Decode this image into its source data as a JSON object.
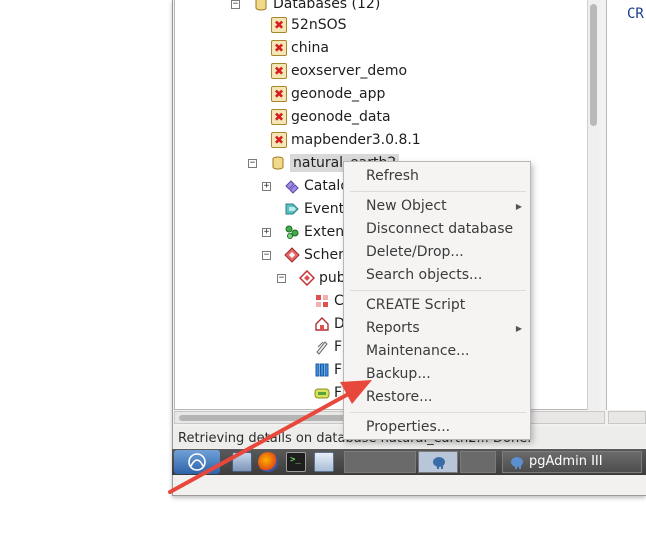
{
  "tree": {
    "items": [
      {
        "label": "Databases (12)"
      },
      {
        "label": "52nSOS"
      },
      {
        "label": "china"
      },
      {
        "label": "eoxserver_demo"
      },
      {
        "label": "geonode_app"
      },
      {
        "label": "geonode_data"
      },
      {
        "label": "mapbender3.0.8.1"
      },
      {
        "label": "natural_earth2"
      },
      {
        "label": "Catalo"
      },
      {
        "label": "Event"
      },
      {
        "label": "Exten"
      },
      {
        "label": "Schem"
      },
      {
        "label": "pub"
      },
      {
        "label": "C"
      },
      {
        "label": "D"
      },
      {
        "label": "F"
      },
      {
        "label": "F"
      },
      {
        "label": "F"
      }
    ]
  },
  "right_pane": {
    "text": "CR"
  },
  "context_menu": {
    "items": [
      {
        "label": "Refresh"
      },
      {
        "label": "New Object"
      },
      {
        "label": "Disconnect database"
      },
      {
        "label": "Delete/Drop..."
      },
      {
        "label": "Search objects..."
      },
      {
        "label": "CREATE Script"
      },
      {
        "label": "Reports"
      },
      {
        "label": "Maintenance..."
      },
      {
        "label": "Backup..."
      },
      {
        "label": "Restore..."
      },
      {
        "label": "Properties..."
      }
    ]
  },
  "status_bar": {
    "text": "Retrieving details on database natural_earth2... Done."
  },
  "taskbar": {
    "task_label": "pgAdmin III"
  },
  "colors": {
    "arrow": "#e8483c",
    "error_x": "#d42020",
    "db_yellow": "#f5e6b8",
    "taskbar": "#4a4a4a"
  },
  "icons": [
    "collapse-icon",
    "expand-icon",
    "database-icon",
    "database-error-icon",
    "catalogs-icon",
    "event-triggers-icon",
    "extensions-icon",
    "schemas-icon",
    "schema-icon",
    "submenu-arrow-icon",
    "firefox-icon",
    "terminal-icon",
    "pgadmin-elephant-icon",
    "red-arrow-annotation"
  ]
}
